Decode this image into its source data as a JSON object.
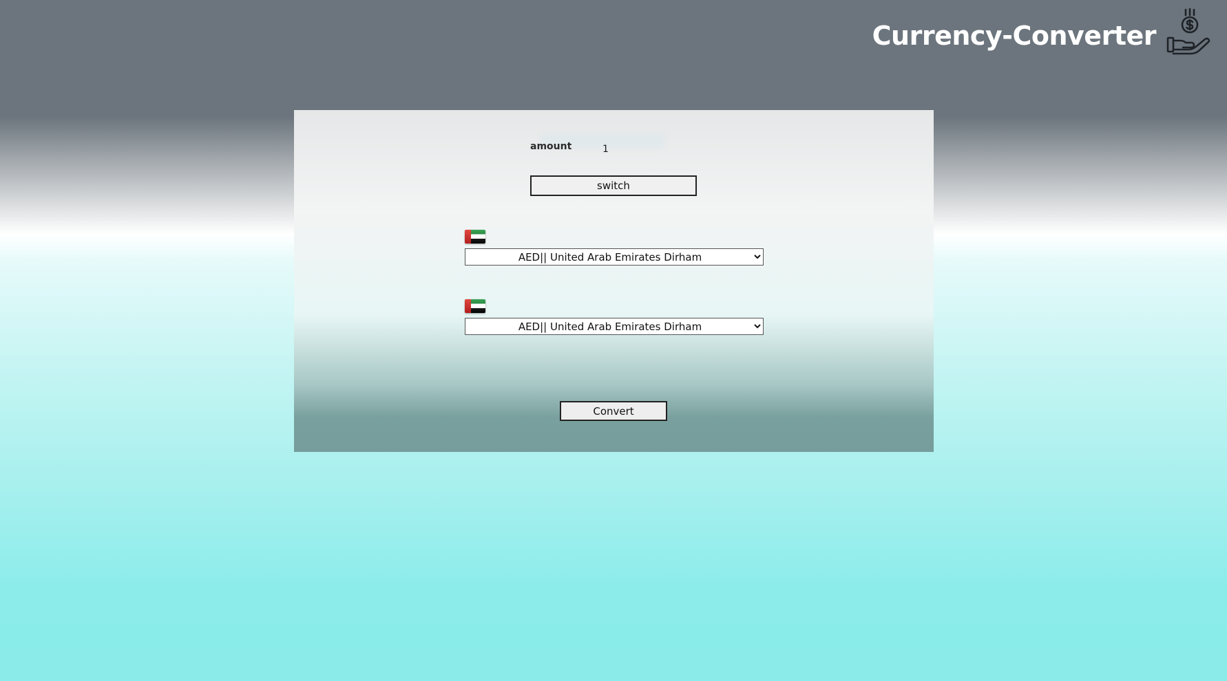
{
  "header": {
    "title": "Currency-Converter",
    "icon": "hand-money-icon"
  },
  "form": {
    "amount_label": "amount",
    "amount_value": "1",
    "switch_label": "switch",
    "from": {
      "flag": "ae-flag-icon",
      "selected": "AED|| United Arab Emirates Dirham"
    },
    "to": {
      "flag": "ae-flag-icon",
      "selected": "AED|| United Arab Emirates Dirham"
    },
    "convert_label": "Convert"
  },
  "colors": {
    "header_bg": "#6c757d",
    "page_bottom": "#8aebe8",
    "title_text": "#ffffff"
  }
}
